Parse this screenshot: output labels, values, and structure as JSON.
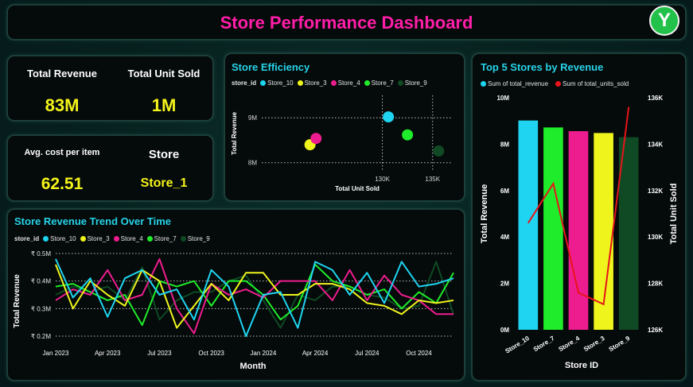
{
  "header": {
    "title": "Store Performance Dashboard",
    "logo_letter": "Y"
  },
  "kpis": {
    "total_revenue_label": "Total Revenue",
    "total_revenue_value": "83M",
    "total_units_label": "Total Unit Sold",
    "total_units_value": "1M",
    "avg_cost_label": "Avg. cost per item",
    "avg_cost_value": "62.51",
    "store_label": "Store",
    "store_value": "Store_1"
  },
  "colors": {
    "Store_10": "#1ed4f0",
    "Store_3": "#eef41c",
    "Store_4": "#ee1d8f",
    "Store_7": "#1fec2a",
    "Store_9": "#0f4a24",
    "units_line": "#e8141a",
    "title_accent": "#ff1ea8"
  },
  "chart_data": [
    {
      "type": "scatter",
      "title": "Store Efficiency",
      "legend_title": "store_id",
      "xlabel": "Total Unit Sold",
      "ylabel": "Total Revenue",
      "xlim": [
        118000,
        137000
      ],
      "ylim": [
        7800000,
        9500000
      ],
      "x_ticks": [
        130000,
        135000
      ],
      "x_tick_labels": [
        "130K",
        "135K"
      ],
      "y_ticks": [
        8000000,
        9000000
      ],
      "y_tick_labels": [
        "8M",
        "9M"
      ],
      "series": [
        {
          "name": "Store_10",
          "x": 130600,
          "y": 9020000
        },
        {
          "name": "Store_3",
          "x": 122800,
          "y": 8400000
        },
        {
          "name": "Store_4",
          "x": 123400,
          "y": 8540000
        },
        {
          "name": "Store_7",
          "x": 132500,
          "y": 8620000
        },
        {
          "name": "Store_9",
          "x": 135600,
          "y": 8260000
        }
      ]
    },
    {
      "type": "bar",
      "title": "Top 5 Stores by Revenue",
      "xlabel": "Store ID",
      "ylabel": "Total Revenue",
      "y2label": "Total Unit Sold",
      "categories": [
        "Store_10",
        "Store_7",
        "Store_4",
        "Store_3",
        "Store_9"
      ],
      "ylim": [
        0,
        10000000
      ],
      "y_ticks": [
        0,
        2000000,
        4000000,
        6000000,
        8000000,
        10000000
      ],
      "y_tick_labels": [
        "0M",
        "2M",
        "4M",
        "6M",
        "8M",
        "10M"
      ],
      "y2lim": [
        126000,
        136000
      ],
      "y2_ticks": [
        126000,
        128000,
        130000,
        132000,
        134000,
        136000
      ],
      "y2_tick_labels": [
        "126K",
        "128K",
        "130K",
        "132K",
        "134K",
        "136K"
      ],
      "series": [
        {
          "name": "Sum of total_revenue",
          "kind": "bar",
          "values": [
            9020000,
            8720000,
            8560000,
            8480000,
            8300000
          ]
        },
        {
          "name": "Sum of total_units_sold",
          "kind": "line",
          "values": [
            130600,
            132300,
            127600,
            127100,
            135600
          ]
        }
      ]
    },
    {
      "type": "line",
      "title": "Store Revenue Trend Over Time",
      "legend_title": "store_id",
      "xlabel": "Month",
      "ylabel": "Total Revenue",
      "ylim": [
        180000,
        520000
      ],
      "y_ticks": [
        200000,
        300000,
        400000,
        500000
      ],
      "y_tick_labels": [
        "₹ 0.2M",
        "₹ 0.3M",
        "₹ 0.4M",
        "₹ 0.5M"
      ],
      "x": [
        "Jan 2023",
        "Feb 2023",
        "Mar 2023",
        "Apr 2023",
        "May 2023",
        "Jun 2023",
        "Jul 2023",
        "Aug 2023",
        "Sep 2023",
        "Oct 2023",
        "Nov 2023",
        "Dec 2023",
        "Jan 2024",
        "Feb 2024",
        "Mar 2024",
        "Apr 2024",
        "May 2024",
        "Jun 2024",
        "Jul 2024",
        "Aug 2024",
        "Sep 2024",
        "Oct 2024",
        "Nov 2024",
        "Dec 2024"
      ],
      "x_tick_labels": [
        "Jan 2023",
        "",
        "",
        "Apr 2023",
        "",
        "",
        "Jul 2023",
        "",
        "",
        "Oct 2023",
        "",
        "",
        "Jan 2024",
        "",
        "",
        "Apr 2024",
        "",
        "",
        "Jul 2024",
        "",
        "",
        "Oct 2024",
        "",
        ""
      ],
      "series": [
        {
          "name": "Store_10",
          "values": [
            480000,
            340000,
            410000,
            270000,
            410000,
            440000,
            350000,
            370000,
            260000,
            440000,
            380000,
            200000,
            350000,
            360000,
            230000,
            470000,
            440000,
            350000,
            430000,
            320000,
            470000,
            380000,
            390000,
            410000
          ]
        },
        {
          "name": "Store_3",
          "values": [
            460000,
            300000,
            400000,
            350000,
            310000,
            440000,
            400000,
            230000,
            310000,
            390000,
            330000,
            430000,
            430000,
            350000,
            350000,
            390000,
            390000,
            370000,
            320000,
            310000,
            280000,
            330000,
            320000,
            330000
          ]
        },
        {
          "name": "Store_4",
          "values": [
            330000,
            370000,
            350000,
            440000,
            330000,
            350000,
            480000,
            300000,
            210000,
            390000,
            350000,
            370000,
            340000,
            400000,
            400000,
            400000,
            330000,
            440000,
            330000,
            420000,
            350000,
            330000,
            280000,
            280000
          ]
        },
        {
          "name": "Store_7",
          "values": [
            380000,
            390000,
            360000,
            330000,
            350000,
            240000,
            400000,
            380000,
            400000,
            310000,
            400000,
            400000,
            350000,
            260000,
            310000,
            460000,
            400000,
            380000,
            350000,
            370000,
            300000,
            360000,
            320000,
            430000
          ]
        },
        {
          "name": "Store_9",
          "values": [
            350000,
            380000,
            360000,
            380000,
            330000,
            450000,
            260000,
            330000,
            360000,
            360000,
            400000,
            420000,
            330000,
            230000,
            350000,
            330000,
            380000,
            380000,
            350000,
            340000,
            300000,
            310000,
            470000,
            280000
          ]
        }
      ]
    }
  ]
}
